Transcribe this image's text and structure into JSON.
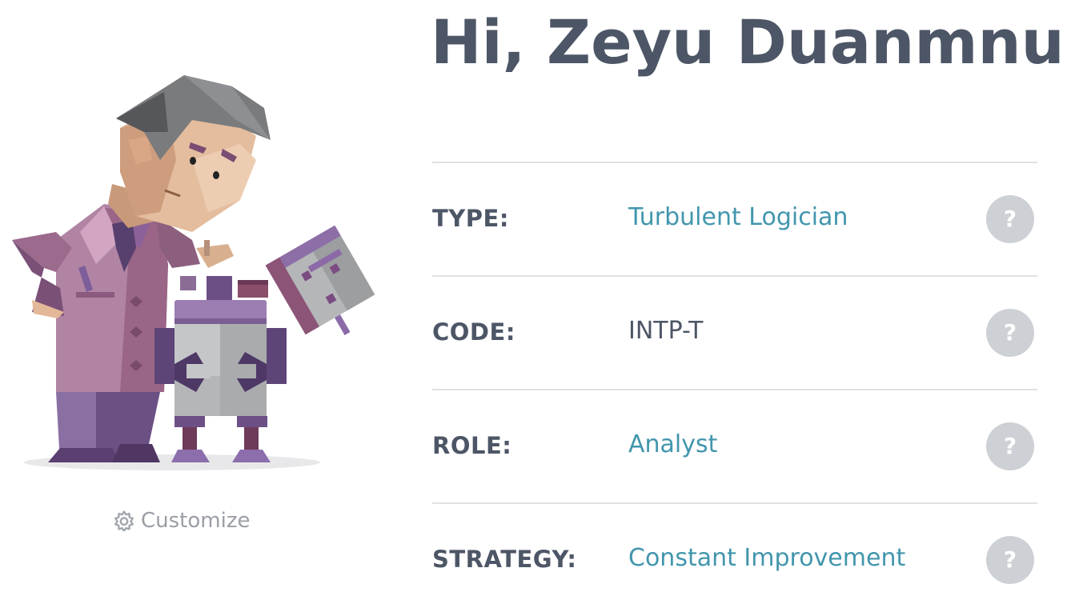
{
  "greeting": "Hi, Zeyu Duanmnu!",
  "customize": {
    "label": "Customize",
    "icon": "gear-icon"
  },
  "profile_rows": [
    {
      "label": "TYPE:",
      "value": "Turbulent Logician",
      "help": "?"
    },
    {
      "label": "CODE:",
      "value": "INTP-T",
      "help": "?"
    },
    {
      "label": "ROLE:",
      "value": "Analyst",
      "help": "?"
    },
    {
      "label": "STRATEGY:",
      "value": "Constant Improvement",
      "help": "?"
    }
  ],
  "colors": {
    "heading": "#4d5666",
    "link": "#4296ad",
    "help_bg": "#cdd0d4",
    "divider": "#dfe1e4",
    "muted": "#9a9ea5"
  }
}
